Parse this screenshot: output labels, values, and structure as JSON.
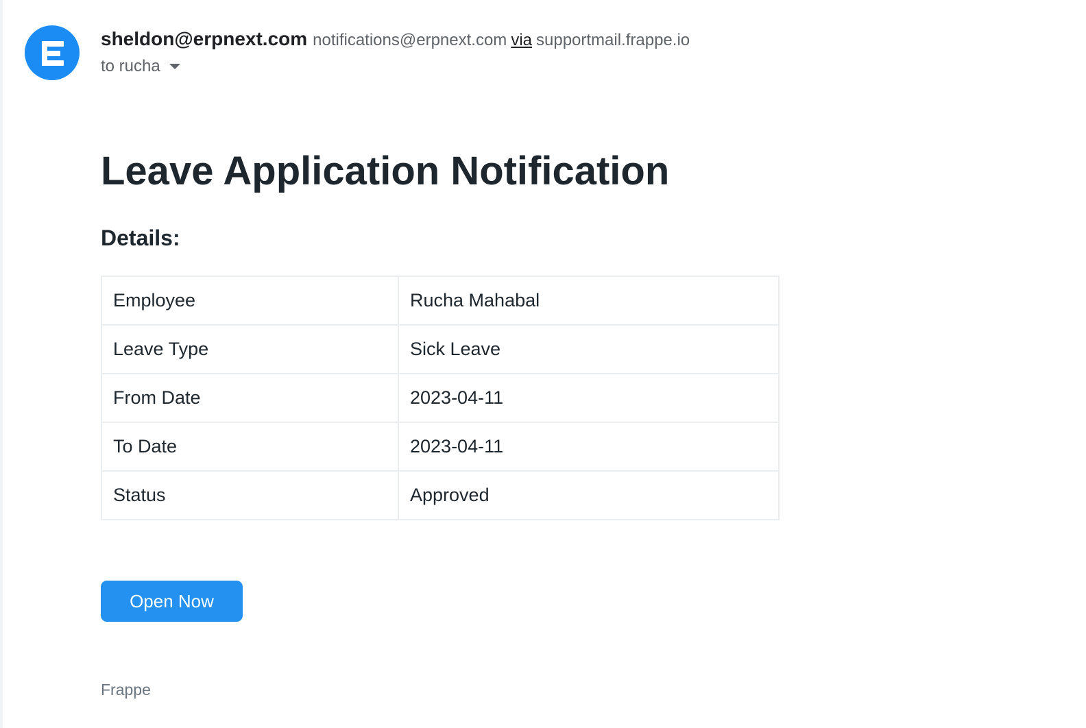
{
  "sender": {
    "name": "sheldon@erpnext.com",
    "address": "notifications@erpnext.com",
    "via_label": "via",
    "relay": "supportmail.frappe.io",
    "recipient": "to rucha"
  },
  "icons": {
    "avatar": "erpnext-logo-icon",
    "recipient_toggle": "caret-down-icon"
  },
  "colors": {
    "avatar": "#1c8cf5",
    "button": "#2490ef"
  },
  "email": {
    "title": "Leave Application Notification",
    "subtitle": "Details:",
    "details": [
      {
        "label": "Employee",
        "value": "Rucha Mahabal"
      },
      {
        "label": "Leave Type",
        "value": "Sick Leave"
      },
      {
        "label": "From Date",
        "value": "2023-04-11"
      },
      {
        "label": "To Date",
        "value": "2023-04-11"
      },
      {
        "label": "Status",
        "value": "Approved"
      }
    ],
    "button_label": "Open Now",
    "footer": "Frappe"
  }
}
